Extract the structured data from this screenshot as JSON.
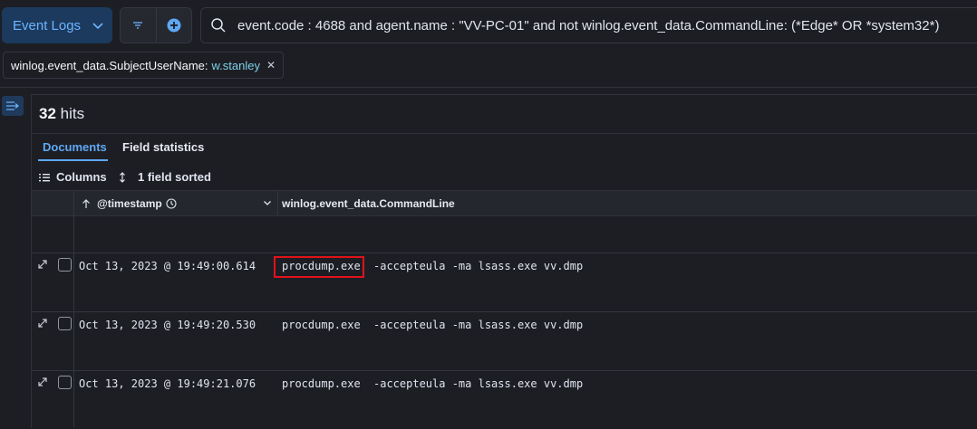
{
  "top_bar": {
    "dataview_label": "Event Logs",
    "query": "event.code : 4688 and agent.name : \"VV-PC-01\" and not winlog.event_data.CommandLine: (*Edge* OR *system32*)",
    "filter_pill": {
      "field": "winlog.event_data.SubjectUserName:",
      "value": "w.stanley"
    }
  },
  "results": {
    "hits_count": "32",
    "hits_label": "hits",
    "tabs": [
      {
        "label": "Documents",
        "active": true
      },
      {
        "label": "Field statistics",
        "active": false
      }
    ],
    "toolbar": {
      "columns_label": "Columns",
      "sorted_label": "1 field sorted"
    },
    "columns": [
      {
        "label": "@timestamp"
      },
      {
        "label": "winlog.event_data.CommandLine"
      }
    ],
    "rows": [
      {
        "timestamp": "Oct 13, 2023 @ 19:49:00.614",
        "command": "procdump.exe",
        "args": "-accepteula -ma lsass.exe vv.dmp"
      },
      {
        "timestamp": "Oct 13, 2023 @ 19:49:20.530",
        "command": "procdump.exe",
        "args": "-accepteula -ma lsass.exe vv.dmp"
      },
      {
        "timestamp": "Oct 13, 2023 @ 19:49:21.076",
        "command": "procdump.exe",
        "args": "-accepteula -ma lsass.exe vv.dmp"
      }
    ]
  },
  "icons": {
    "dataview_chevron": "chevron-down-icon",
    "filter": "filter-icon",
    "add_filter": "plus-circle-icon",
    "search": "search-icon",
    "pill_close": "close-icon",
    "sidebar_toggle": "sidebar-collapse-icon",
    "columns": "list-icon",
    "sort": "sort-icon",
    "sort_asc": "arrow-up-icon",
    "clock": "clock-icon",
    "column_menu": "chevron-down-icon",
    "expand_row": "expand-icon"
  },
  "colors": {
    "accent": "#5fa8f5",
    "highlight": "#e0121a",
    "filter_value": "#7dd0e8"
  }
}
